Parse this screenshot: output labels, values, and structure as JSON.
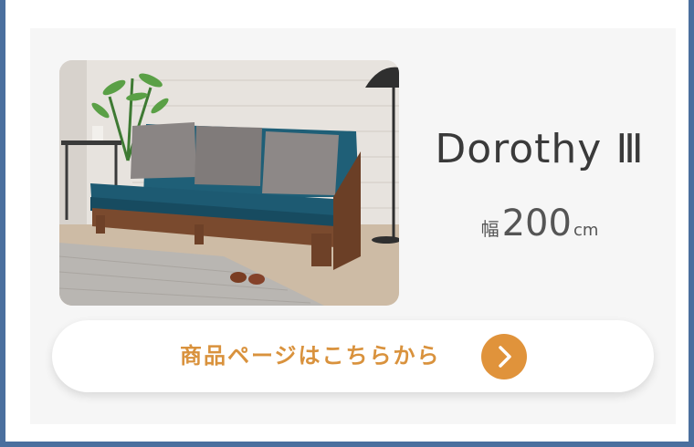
{
  "product": {
    "image_alt": "sofa-photo",
    "name": "Dorothy Ⅲ",
    "width_label": "幅",
    "width_value": "200",
    "width_unit": "cm"
  },
  "cta": {
    "label": "商品ページはこちらから",
    "icon": "chevron-right-icon"
  },
  "colors": {
    "frame": "#4a6f9e",
    "panel": "#f6f6f6",
    "accent": "#e0933b",
    "cta_text": "#d9923d",
    "sofa_seat": "#1f5f77",
    "wood": "#7a4a2e",
    "cushion": "#8a8584"
  }
}
